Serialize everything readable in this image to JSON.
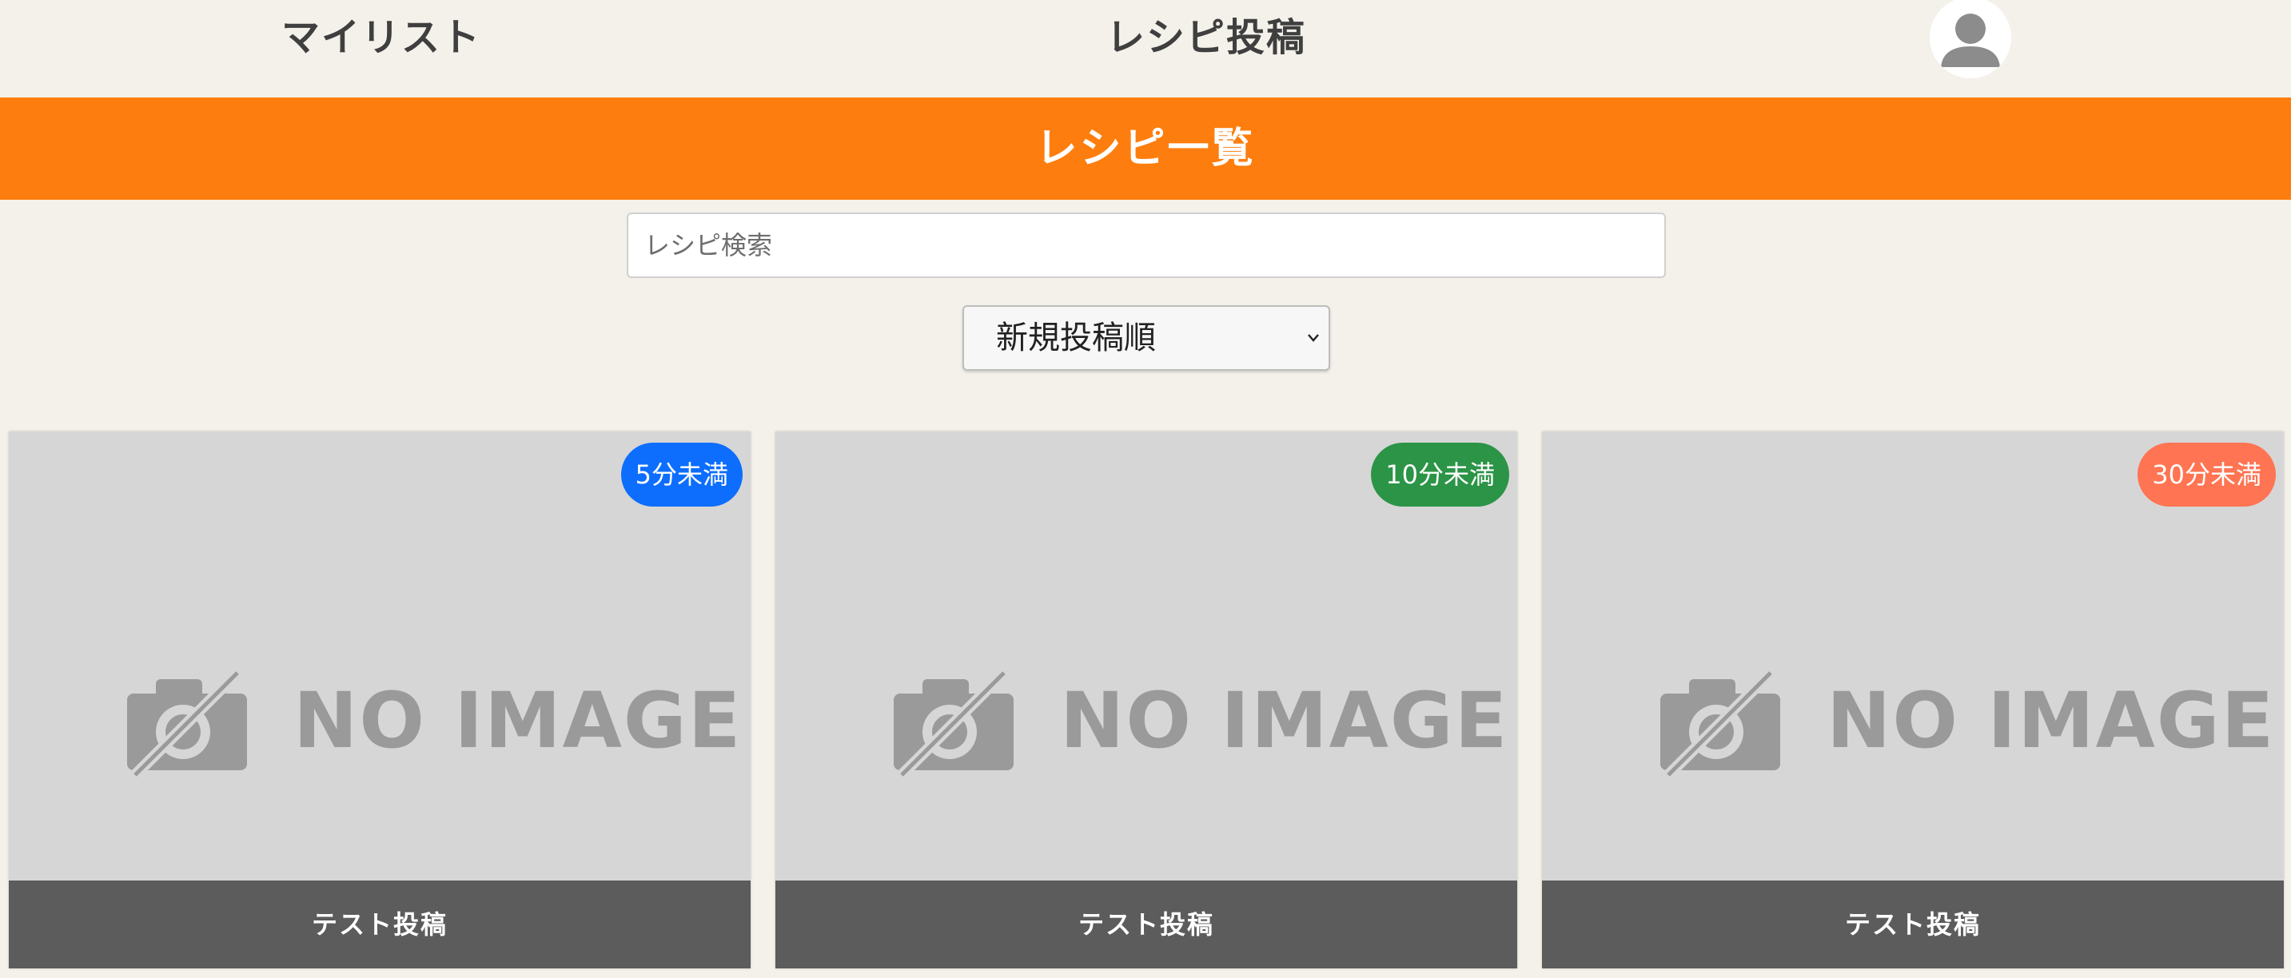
{
  "header": {
    "mylist_label": "マイリスト",
    "post_label": "レシピ投稿",
    "avatar_icon": "user-avatar-icon"
  },
  "title_bar": {
    "title": "レシピ一覧",
    "color": "#fd7e0e"
  },
  "search": {
    "placeholder": "レシピ検索",
    "value": ""
  },
  "sort": {
    "selected": "新規投稿順",
    "icon": "chevron-down-icon"
  },
  "recipes": [
    {
      "title": "テスト投稿",
      "time_badge": "5分未満",
      "badge_color": "#0d6efd",
      "image_text": "NO IMAGE",
      "image_icon": "camera-off-icon"
    },
    {
      "title": "テスト投稿",
      "time_badge": "10分未満",
      "badge_color": "#2b9446",
      "image_text": "NO IMAGE",
      "image_icon": "camera-off-icon"
    },
    {
      "title": "テスト投稿",
      "time_badge": "30分未満",
      "badge_color": "#ff7452",
      "image_text": "NO IMAGE",
      "image_icon": "camera-off-icon"
    }
  ]
}
